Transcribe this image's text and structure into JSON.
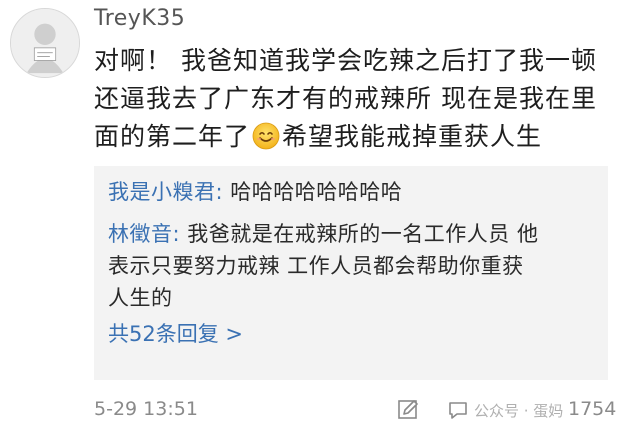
{
  "post": {
    "username": "TreyK35",
    "lines": [
      "对啊！ 我爸知道我学会吃辣之后打了我一顿",
      "还逼我去了广东才有的戒辣所 现在是我在里",
      "面的第二年了",
      "希望我能戒掉重获人生"
    ],
    "emoji_icon": "smile-emoji-icon"
  },
  "replies": [
    {
      "user": "我是小糗君",
      "separator": ": ",
      "text": "哈哈哈哈哈哈哈哈"
    },
    {
      "user": "林徵音",
      "separator": ": ",
      "text_lines": [
        "我爸就是在戒辣所的一名工作人员 他",
        "表示只要努力戒辣 工作人员都会帮助你重获",
        "人生的"
      ]
    }
  ],
  "more_replies": "共52条回复 >",
  "footer": {
    "timestamp": "5-29 13:51",
    "watermark": "公众号 · 蛋妈",
    "likes": "1754",
    "icons": [
      "edit-icon",
      "comment-icon"
    ]
  },
  "colors": {
    "link_blue": "#3a71b3",
    "reply_bg": "#f3f3f3",
    "meta_gray": "#8a8a8a"
  }
}
